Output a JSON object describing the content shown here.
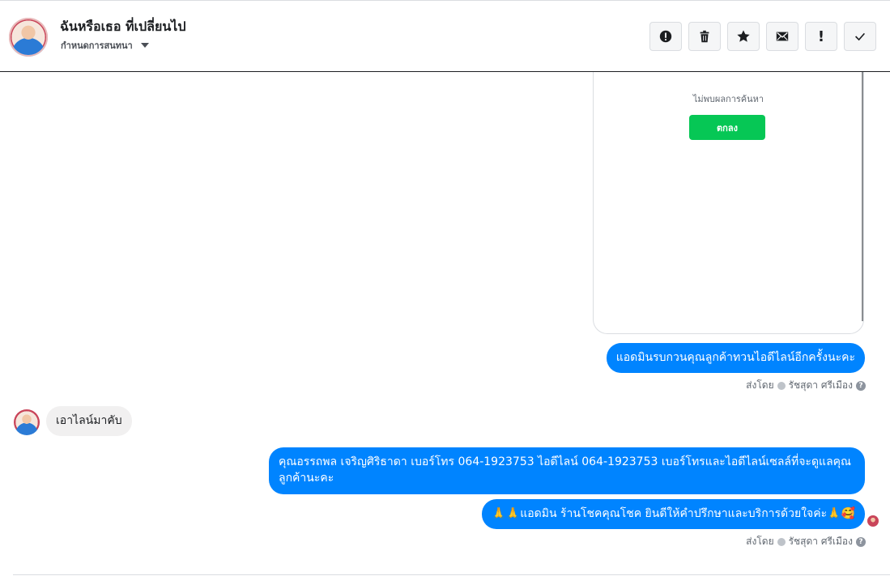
{
  "header": {
    "contact_name": "ฉันหรือเธอ ที่เปลี่ยนไป",
    "assign_label": "กำหนดการสนทนา",
    "actions": [
      {
        "name": "spam-button",
        "icon": "alert-circle-icon"
      },
      {
        "name": "delete-button",
        "icon": "trash-icon"
      },
      {
        "name": "star-button",
        "icon": "star-icon"
      },
      {
        "name": "mark-unread-button",
        "icon": "envelope-icon"
      },
      {
        "name": "important-button",
        "icon": "exclamation-icon",
        "label": "!"
      },
      {
        "name": "mark-done-button",
        "icon": "checkmark-icon"
      }
    ]
  },
  "messages": {
    "image_card": {
      "no_result_text": "ไม่พบผลการค้นหา",
      "ok_label": "ตกลง",
      "ok_color": "#06c755"
    },
    "out_1": "แอดมินรบกวนคุณลูกค้าทวนไอดีไลน์อีกครั้งนะคะ",
    "sent_by_1": {
      "prefix": "ส่งโดย",
      "agent": "รัชสุดา ศรีเมือง"
    },
    "in_1": "เอาไลน์มาคับ",
    "out_2": "คุณอรรถพล เจริญศิริธาดา      เบอร์โทร 064-1923753 ไอดีไลน์ 064-1923753   เบอร์โทรและไอดีไลน์เซลล์ที่จะดูแลคุณลูกค้านะคะ",
    "out_3": "🙏🙏แอดมิน ร้านโชคคุณโชค ยินดีให้คำปรึกษาและบริการด้วยใจค่ะ🙏🥰",
    "sent_by_2": {
      "prefix": "ส่งโดย",
      "agent": "รัชสุดา ศรีเมือง"
    }
  },
  "colors": {
    "outgoing": "#0084ff",
    "incoming": "#f1f0f0"
  }
}
